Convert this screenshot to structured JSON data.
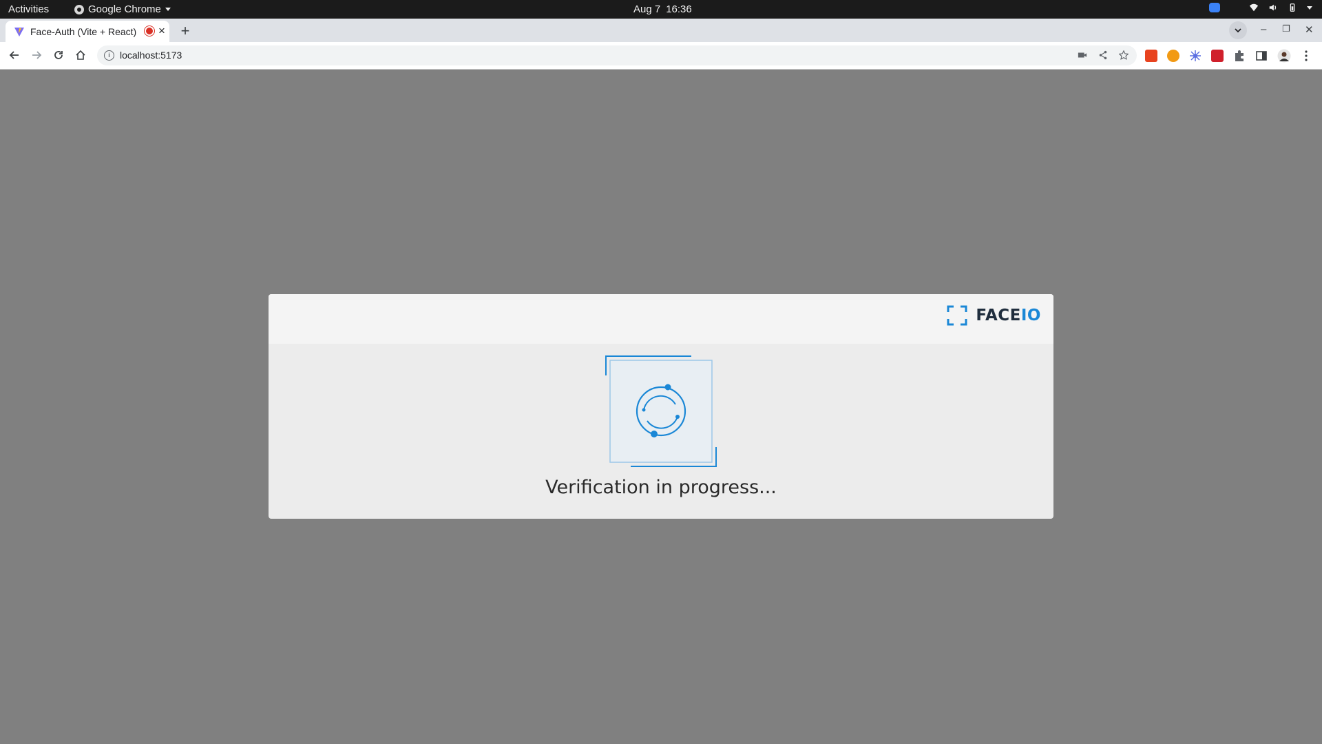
{
  "system_bar": {
    "activities": "Activities",
    "app_name": "Google Chrome",
    "date": "Aug 7",
    "time": "16:36"
  },
  "browser": {
    "tab_title": "Face-Auth (Vite + React)",
    "new_tab_symbol": "+",
    "tab_close_symbol": "×",
    "url": "localhost:5173",
    "window_controls": [
      "–",
      "❐",
      "✕"
    ]
  },
  "modal": {
    "brand_face": "FACE",
    "brand_io": "IO",
    "status_text": "Verification in progress...",
    "accent_color": "#1a87d6"
  },
  "icons": {
    "tray": [
      "zoom-icon",
      "wifi-icon",
      "volume-icon",
      "battery-icon",
      "power-menu-icon"
    ],
    "extensions": [
      "extension-red-icon",
      "extension-orange-icon",
      "extension-blue-icon",
      "extension-red2-icon",
      "extensions-puzzle-icon",
      "side-panel-icon",
      "profile-avatar-icon",
      "menu-dots-icon"
    ]
  }
}
